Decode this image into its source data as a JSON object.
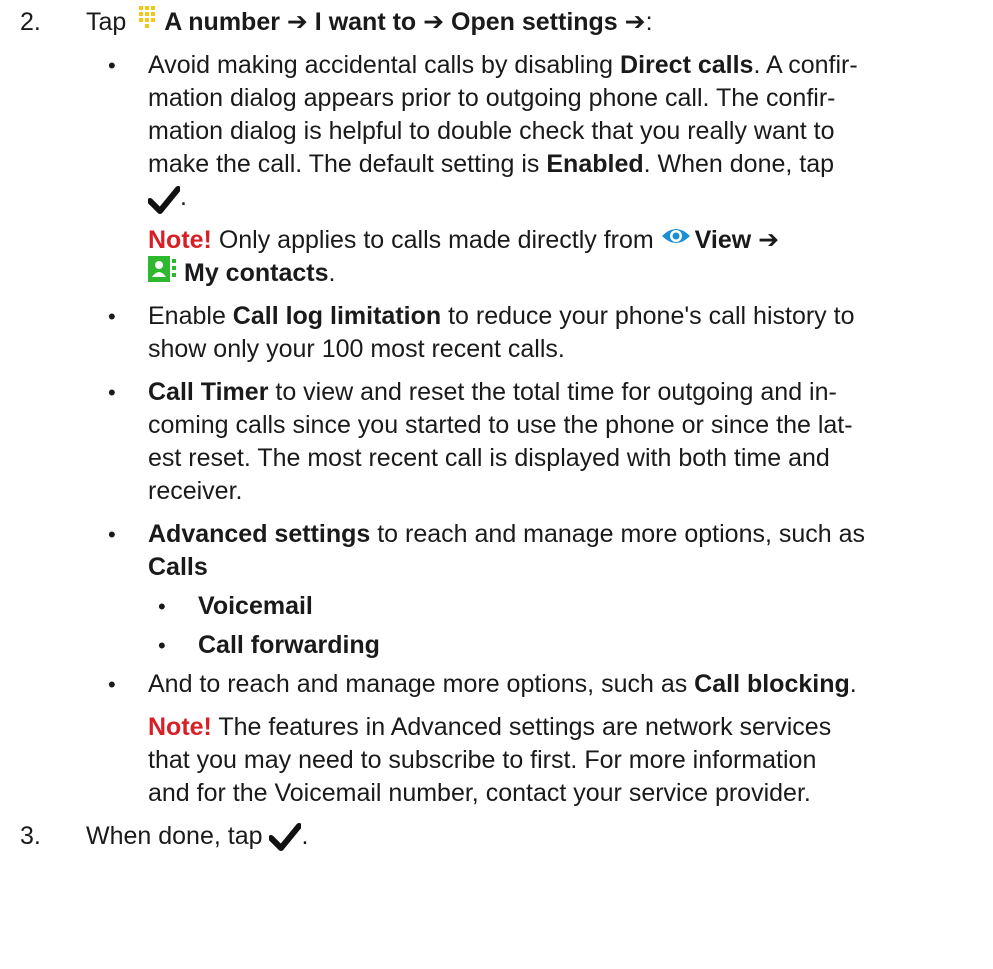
{
  "step2": {
    "number": "2.",
    "tap": "Tap",
    "path": "A number ➔ I want to ➔ Open settings ➔",
    "colon": ":",
    "icons": {
      "dialpad": "dialpad-icon"
    }
  },
  "direct_calls": {
    "l1a": "Avoid making accidental calls by disabling ",
    "l1b": "Direct calls",
    "l1c": ". A confir-",
    "l2": "mation dialog appears prior to outgoing phone call. The confir-",
    "l3": "mation dialog is helpful to double check that you really want to",
    "l4a": "make the call. The default setting is ",
    "l4b": "Enabled",
    "l4c": ". When done, tap",
    "l5": ".",
    "note_label": "Note!",
    "note_text": " Only applies to calls made directly from ",
    "view_label": "View ➔",
    "contacts_label": "My contacts",
    "contacts_period": "."
  },
  "call_log": {
    "l1a": "Enable ",
    "l1b": "Call log limitation",
    "l1c": " to reduce your phone's call history to",
    "l2": "show only your 100 most recent calls."
  },
  "call_timer": {
    "l1a": "Call Timer",
    "l1b": " to view and reset the total time for outgoing and in-",
    "l2": "coming calls since you started to use the phone or since the lat-",
    "l3": "est reset. The most recent call is displayed with both time and",
    "l4": "receiver."
  },
  "advanced": {
    "l1a": "Advanced settings",
    "l1b": " to reach and manage more options, such as",
    "l2": "Calls",
    "sub1": "Voicemail",
    "sub2": "Call forwarding"
  },
  "blocking": {
    "l1a": "And to reach and manage more options, such as ",
    "l1b": "Call blocking",
    "l1c": "."
  },
  "advanced_note": {
    "label": "Note!",
    "l1": " The features in Advanced settings are network services",
    "l2": "that you may need to subscribe to first. For more information",
    "l3": "and for the Voicemail number, contact your service provider."
  },
  "step3": {
    "number": "3.",
    "text": "When done, tap ",
    "period": "."
  },
  "bullet_char": "•",
  "colors": {
    "text": "#1a1a1a",
    "accent": "#d91f26",
    "dialpad": "#f5c518",
    "view": "#1a8fd6",
    "contacts": "#2eb82e"
  }
}
